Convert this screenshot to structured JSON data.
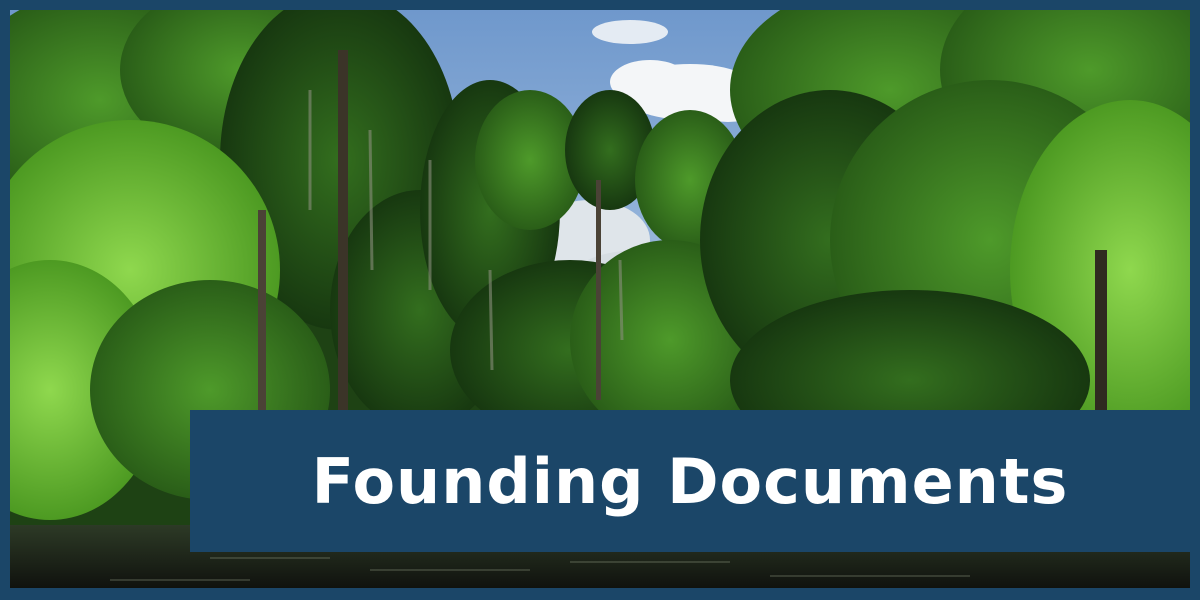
{
  "banner": {
    "title": "Founding Documents"
  },
  "photo": {
    "subject": "photo"
  },
  "colors": {
    "frame": "#1b4668",
    "banner": "#1b4668",
    "title_text": "#ffffff",
    "sky": "#7fa6d4",
    "foliage_light": "#6dc23a",
    "foliage_dark": "#1f4a14",
    "water": "#1a1d18"
  }
}
